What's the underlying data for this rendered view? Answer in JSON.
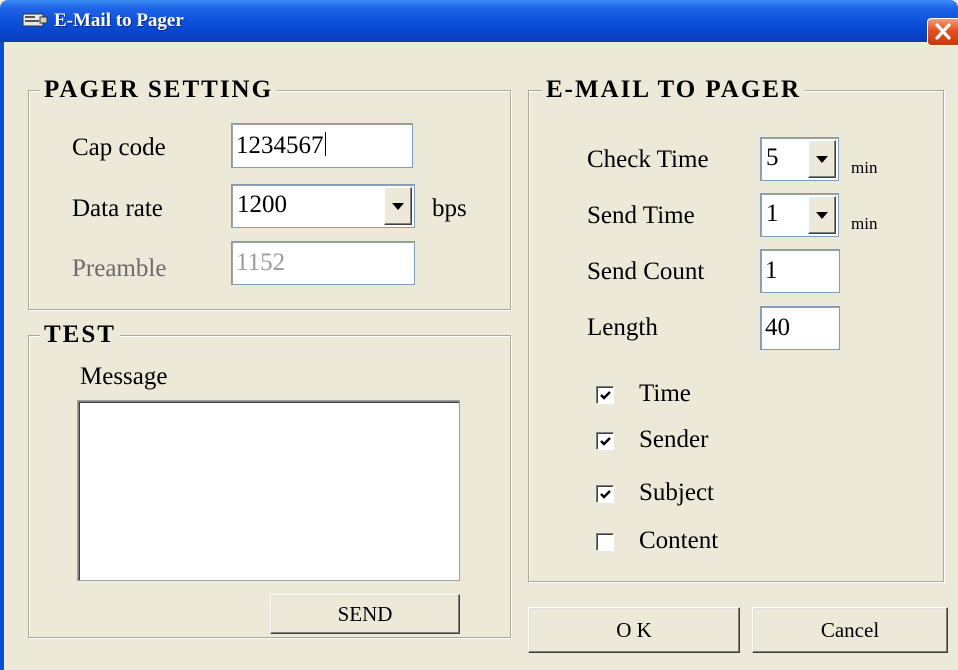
{
  "window": {
    "title": "E-Mail to Pager"
  },
  "pager_setting": {
    "title": "PAGER SETTING",
    "cap_code_label": "Cap code",
    "cap_code_value": "1234567",
    "data_rate_label": "Data rate",
    "data_rate_value": "1200",
    "data_rate_unit": "bps",
    "preamble_label": "Preamble",
    "preamble_value": "1152"
  },
  "test": {
    "title": "TEST",
    "message_label": "Message",
    "message_value": "",
    "send_label": "SEND"
  },
  "email_to_pager": {
    "title": "E-MAIL TO PAGER",
    "check_time_label": "Check Time",
    "check_time_value": "5",
    "check_time_unit": "min",
    "send_time_label": "Send Time",
    "send_time_value": "1",
    "send_time_unit": "min",
    "send_count_label": "Send Count",
    "send_count_value": "1",
    "length_label": "Length",
    "length_value": "40",
    "options": [
      {
        "label": "Time",
        "checked": true
      },
      {
        "label": "Sender",
        "checked": true
      },
      {
        "label": "Subject",
        "checked": true
      },
      {
        "label": "Content",
        "checked": false
      }
    ]
  },
  "buttons": {
    "ok": "O K",
    "cancel": "Cancel"
  }
}
